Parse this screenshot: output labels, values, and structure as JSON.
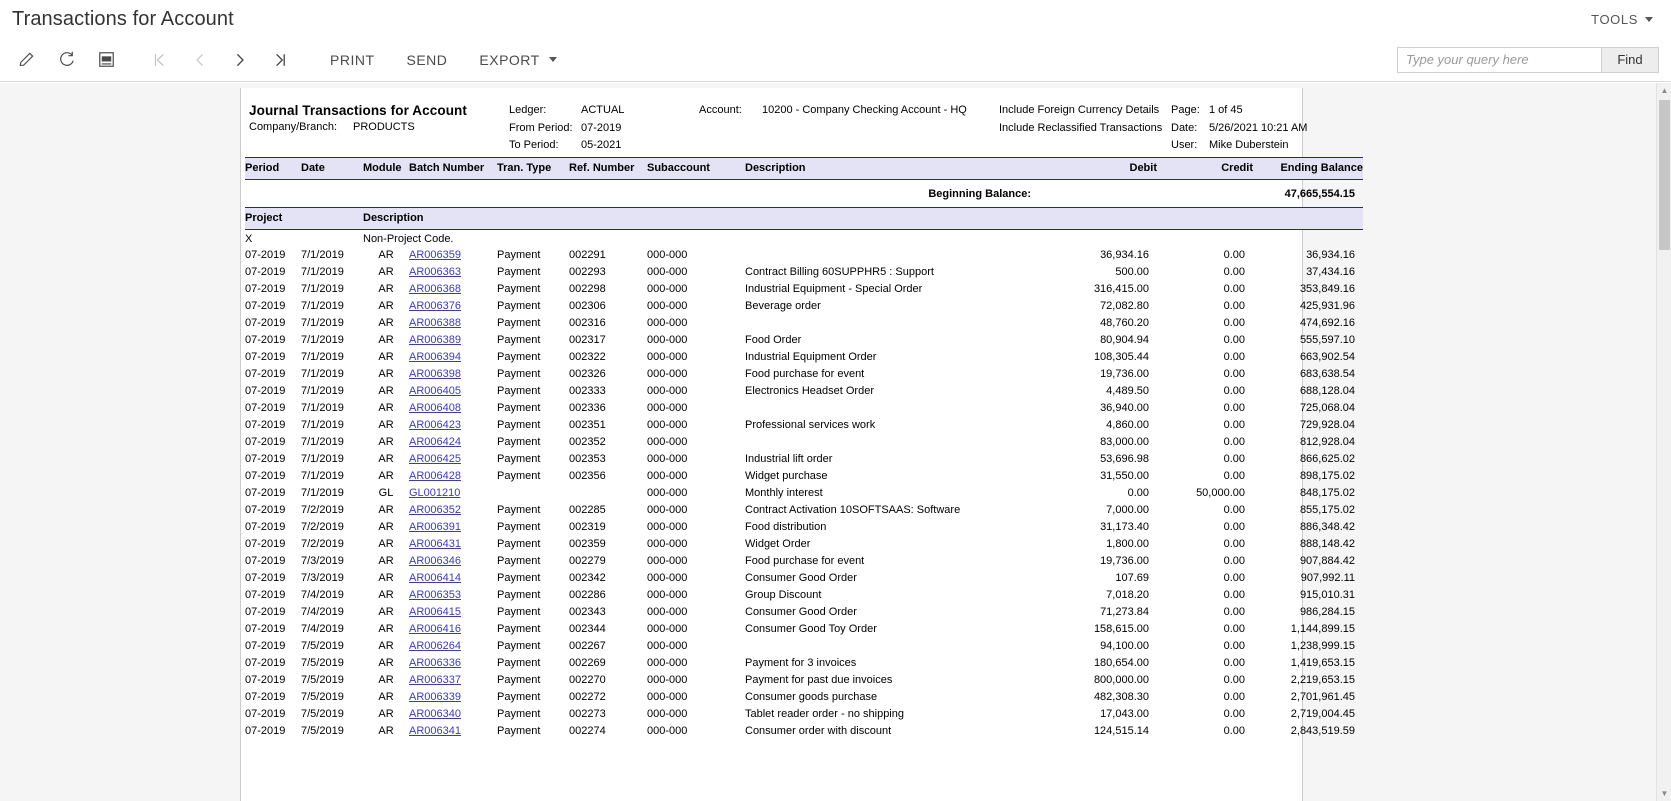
{
  "window": {
    "title": "Transactions for Account",
    "tools_label": "TOOLS"
  },
  "toolbar": {
    "icons": [
      {
        "name": "edit-pencil-icon",
        "glyph": "pencil"
      },
      {
        "name": "refresh-icon",
        "glyph": "refresh"
      },
      {
        "name": "pdf-icon",
        "glyph": "pdf"
      }
    ],
    "nav": [
      {
        "name": "first-page-button",
        "glyph": "|<",
        "disabled": true
      },
      {
        "name": "previous-page-button",
        "glyph": "<",
        "disabled": true
      },
      {
        "name": "next-page-button",
        "glyph": ">",
        "disabled": false
      },
      {
        "name": "last-page-button",
        "glyph": ">|",
        "disabled": false
      }
    ],
    "print_label": "PRINT",
    "send_label": "SEND",
    "export_label": "EXPORT"
  },
  "search": {
    "placeholder": "Type your query here",
    "value": "",
    "find_label": "Find"
  },
  "report_header": {
    "title": "Journal Transactions for Account",
    "company_branch_label": "Company/Branch:",
    "company_branch_value": "PRODUCTS",
    "ledger_label": "Ledger:",
    "ledger_value": "ACTUAL",
    "from_period_label": "From Period:",
    "from_period_value": "07-2019",
    "to_period_label": "To Period:",
    "to_period_value": "05-2021",
    "account_label": "Account:",
    "account_value": "10200 - Company Checking Account - HQ",
    "include_line_1": "Include Foreign Currency Details",
    "include_line_2": "Include Reclassified Transactions",
    "page_label": "Page:",
    "page_value": "1 of 45",
    "date_label": "Date:",
    "date_value": "5/26/2021 10:21 AM",
    "user_label": "User:",
    "user_value": "Mike Duberstein"
  },
  "table": {
    "columns": [
      "Period",
      "Date",
      "Module",
      "Batch Number",
      "Tran. Type",
      "Ref. Number",
      "Subaccount",
      "Description",
      "Debit",
      "Credit",
      "Ending Balance"
    ],
    "beginning_balance_label": "Beginning Balance:",
    "beginning_balance_value": "47,665,554.15",
    "project_header": {
      "project": "Project",
      "description": "Description"
    },
    "project_row": {
      "project": "X",
      "description": "Non-Project Code."
    },
    "rows": [
      {
        "period": "07-2019",
        "date": "7/1/2019",
        "module": "AR",
        "batch": "AR006359",
        "tran": "Payment",
        "ref": "002291",
        "sub": "000-000",
        "desc": "",
        "debit": "36,934.16",
        "credit": "0.00",
        "ending": "36,934.16"
      },
      {
        "period": "07-2019",
        "date": "7/1/2019",
        "module": "AR",
        "batch": "AR006363",
        "tran": "Payment",
        "ref": "002293",
        "sub": "000-000",
        "desc": "Contract Billing 60SUPPHR5 : Support",
        "debit": "500.00",
        "credit": "0.00",
        "ending": "37,434.16"
      },
      {
        "period": "07-2019",
        "date": "7/1/2019",
        "module": "AR",
        "batch": "AR006368",
        "tran": "Payment",
        "ref": "002298",
        "sub": "000-000",
        "desc": "Industrial Equipment - Special Order",
        "debit": "316,415.00",
        "credit": "0.00",
        "ending": "353,849.16"
      },
      {
        "period": "07-2019",
        "date": "7/1/2019",
        "module": "AR",
        "batch": "AR006376",
        "tran": "Payment",
        "ref": "002306",
        "sub": "000-000",
        "desc": "Beverage order",
        "debit": "72,082.80",
        "credit": "0.00",
        "ending": "425,931.96"
      },
      {
        "period": "07-2019",
        "date": "7/1/2019",
        "module": "AR",
        "batch": "AR006388",
        "tran": "Payment",
        "ref": "002316",
        "sub": "000-000",
        "desc": "",
        "debit": "48,760.20",
        "credit": "0.00",
        "ending": "474,692.16"
      },
      {
        "period": "07-2019",
        "date": "7/1/2019",
        "module": "AR",
        "batch": "AR006389",
        "tran": "Payment",
        "ref": "002317",
        "sub": "000-000",
        "desc": "Food Order",
        "debit": "80,904.94",
        "credit": "0.00",
        "ending": "555,597.10"
      },
      {
        "period": "07-2019",
        "date": "7/1/2019",
        "module": "AR",
        "batch": "AR006394",
        "tran": "Payment",
        "ref": "002322",
        "sub": "000-000",
        "desc": "Industrial Equipment Order",
        "debit": "108,305.44",
        "credit": "0.00",
        "ending": "663,902.54"
      },
      {
        "period": "07-2019",
        "date": "7/1/2019",
        "module": "AR",
        "batch": "AR006398",
        "tran": "Payment",
        "ref": "002326",
        "sub": "000-000",
        "desc": "Food purchase for event",
        "debit": "19,736.00",
        "credit": "0.00",
        "ending": "683,638.54"
      },
      {
        "period": "07-2019",
        "date": "7/1/2019",
        "module": "AR",
        "batch": "AR006405",
        "tran": "Payment",
        "ref": "002333",
        "sub": "000-000",
        "desc": "Electronics Headset Order",
        "debit": "4,489.50",
        "credit": "0.00",
        "ending": "688,128.04"
      },
      {
        "period": "07-2019",
        "date": "7/1/2019",
        "module": "AR",
        "batch": "AR006408",
        "tran": "Payment",
        "ref": "002336",
        "sub": "000-000",
        "desc": "",
        "debit": "36,940.00",
        "credit": "0.00",
        "ending": "725,068.04"
      },
      {
        "period": "07-2019",
        "date": "7/1/2019",
        "module": "AR",
        "batch": "AR006423",
        "tran": "Payment",
        "ref": "002351",
        "sub": "000-000",
        "desc": "Professional services work",
        "debit": "4,860.00",
        "credit": "0.00",
        "ending": "729,928.04"
      },
      {
        "period": "07-2019",
        "date": "7/1/2019",
        "module": "AR",
        "batch": "AR006424",
        "tran": "Payment",
        "ref": "002352",
        "sub": "000-000",
        "desc": "",
        "debit": "83,000.00",
        "credit": "0.00",
        "ending": "812,928.04"
      },
      {
        "period": "07-2019",
        "date": "7/1/2019",
        "module": "AR",
        "batch": "AR006425",
        "tran": "Payment",
        "ref": "002353",
        "sub": "000-000",
        "desc": "Industrial lift order",
        "debit": "53,696.98",
        "credit": "0.00",
        "ending": "866,625.02"
      },
      {
        "period": "07-2019",
        "date": "7/1/2019",
        "module": "AR",
        "batch": "AR006428",
        "tran": "Payment",
        "ref": "002356",
        "sub": "000-000",
        "desc": "Widget purchase",
        "debit": "31,550.00",
        "credit": "0.00",
        "ending": "898,175.02"
      },
      {
        "period": "07-2019",
        "date": "7/1/2019",
        "module": "GL",
        "batch": "GL001210",
        "tran": "",
        "ref": "",
        "sub": "000-000",
        "desc": "Monthly interest",
        "debit": "0.00",
        "credit": "50,000.00",
        "ending": "848,175.02"
      },
      {
        "period": "07-2019",
        "date": "7/2/2019",
        "module": "AR",
        "batch": "AR006352",
        "tran": "Payment",
        "ref": "002285",
        "sub": "000-000",
        "desc": "Contract Activation 10SOFTSAAS: Software",
        "debit": "7,000.00",
        "credit": "0.00",
        "ending": "855,175.02"
      },
      {
        "period": "07-2019",
        "date": "7/2/2019",
        "module": "AR",
        "batch": "AR006391",
        "tran": "Payment",
        "ref": "002319",
        "sub": "000-000",
        "desc": "Food distribution",
        "debit": "31,173.40",
        "credit": "0.00",
        "ending": "886,348.42"
      },
      {
        "period": "07-2019",
        "date": "7/2/2019",
        "module": "AR",
        "batch": "AR006431",
        "tran": "Payment",
        "ref": "002359",
        "sub": "000-000",
        "desc": "Widget Order",
        "debit": "1,800.00",
        "credit": "0.00",
        "ending": "888,148.42"
      },
      {
        "period": "07-2019",
        "date": "7/3/2019",
        "module": "AR",
        "batch": "AR006346",
        "tran": "Payment",
        "ref": "002279",
        "sub": "000-000",
        "desc": "Food purchase for event",
        "debit": "19,736.00",
        "credit": "0.00",
        "ending": "907,884.42"
      },
      {
        "period": "07-2019",
        "date": "7/3/2019",
        "module": "AR",
        "batch": "AR006414",
        "tran": "Payment",
        "ref": "002342",
        "sub": "000-000",
        "desc": "Consumer Good Order",
        "debit": "107.69",
        "credit": "0.00",
        "ending": "907,992.11"
      },
      {
        "period": "07-2019",
        "date": "7/4/2019",
        "module": "AR",
        "batch": "AR006353",
        "tran": "Payment",
        "ref": "002286",
        "sub": "000-000",
        "desc": "Group Discount",
        "debit": "7,018.20",
        "credit": "0.00",
        "ending": "915,010.31"
      },
      {
        "period": "07-2019",
        "date": "7/4/2019",
        "module": "AR",
        "batch": "AR006415",
        "tran": "Payment",
        "ref": "002343",
        "sub": "000-000",
        "desc": "Consumer Good Order",
        "debit": "71,273.84",
        "credit": "0.00",
        "ending": "986,284.15"
      },
      {
        "period": "07-2019",
        "date": "7/4/2019",
        "module": "AR",
        "batch": "AR006416",
        "tran": "Payment",
        "ref": "002344",
        "sub": "000-000",
        "desc": "Consumer Good Toy Order",
        "debit": "158,615.00",
        "credit": "0.00",
        "ending": "1,144,899.15"
      },
      {
        "period": "07-2019",
        "date": "7/5/2019",
        "module": "AR",
        "batch": "AR006264",
        "tran": "Payment",
        "ref": "002267",
        "sub": "000-000",
        "desc": "",
        "debit": "94,100.00",
        "credit": "0.00",
        "ending": "1,238,999.15"
      },
      {
        "period": "07-2019",
        "date": "7/5/2019",
        "module": "AR",
        "batch": "AR006336",
        "tran": "Payment",
        "ref": "002269",
        "sub": "000-000",
        "desc": "Payment for 3 invoices",
        "debit": "180,654.00",
        "credit": "0.00",
        "ending": "1,419,653.15"
      },
      {
        "period": "07-2019",
        "date": "7/5/2019",
        "module": "AR",
        "batch": "AR006337",
        "tran": "Payment",
        "ref": "002270",
        "sub": "000-000",
        "desc": "Payment for past due invoices",
        "debit": "800,000.00",
        "credit": "0.00",
        "ending": "2,219,653.15"
      },
      {
        "period": "07-2019",
        "date": "7/5/2019",
        "module": "AR",
        "batch": "AR006339",
        "tran": "Payment",
        "ref": "002272",
        "sub": "000-000",
        "desc": "Consumer goods purchase",
        "debit": "482,308.30",
        "credit": "0.00",
        "ending": "2,701,961.45"
      },
      {
        "period": "07-2019",
        "date": "7/5/2019",
        "module": "AR",
        "batch": "AR006340",
        "tran": "Payment",
        "ref": "002273",
        "sub": "000-000",
        "desc": "Tablet reader order - no shipping",
        "debit": "17,043.00",
        "credit": "0.00",
        "ending": "2,719,004.45"
      },
      {
        "period": "07-2019",
        "date": "7/5/2019",
        "module": "AR",
        "batch": "AR006341",
        "tran": "Payment",
        "ref": "002274",
        "sub": "000-000",
        "desc": "Consumer order with discount",
        "debit": "124,515.14",
        "credit": "0.00",
        "ending": "2,843,519.59"
      }
    ]
  }
}
